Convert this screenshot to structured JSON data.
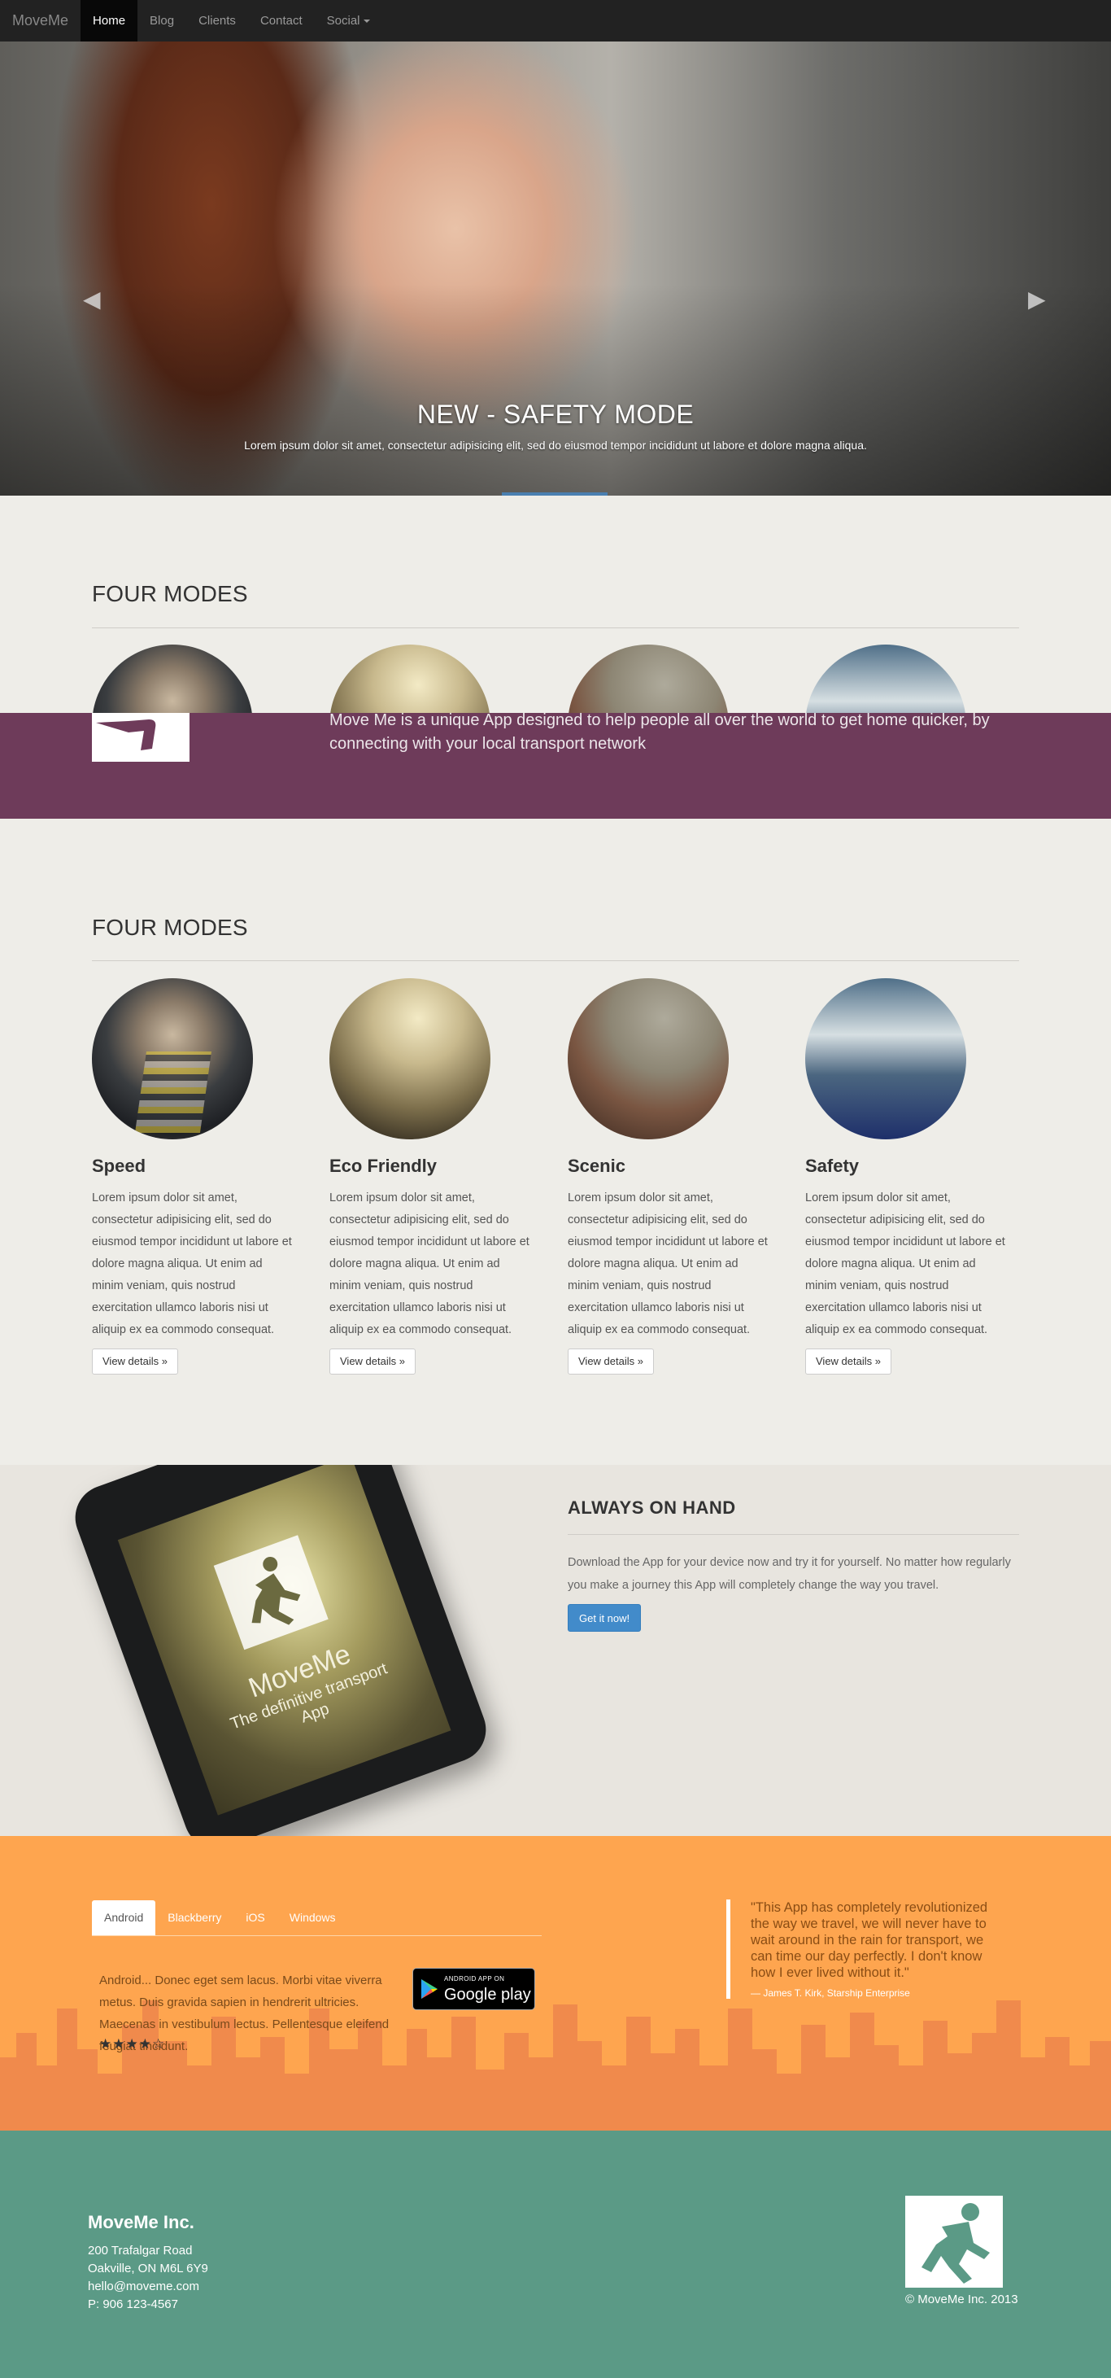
{
  "navbar": {
    "brand": "MoveMe",
    "items": [
      {
        "label": "Home",
        "active": true
      },
      {
        "label": "Blog",
        "active": false
      },
      {
        "label": "Clients",
        "active": false
      },
      {
        "label": "Contact",
        "active": false
      },
      {
        "label": "Social",
        "active": false,
        "dropdown": true
      }
    ]
  },
  "hero": {
    "title": "NEW - SAFETY MODE",
    "text": "Lorem ipsum dolor sit amet, consectetur adipisicing elit, sed do eiusmod tempor incididunt ut labore et dolore magna aliqua.",
    "prev_icon": "chevron-left-icon",
    "next_icon": "chevron-right-icon"
  },
  "intro": {
    "section_title": "FOUR MODES",
    "band_text": "Move Me is a unique App designed to help people all over the world to get home quicker, by connecting with your local transport network"
  },
  "modes": {
    "section_title": "FOUR MODES",
    "items": [
      {
        "title": "Speed",
        "text": "Lorem ipsum dolor sit amet, consectetur adipisicing elit, sed do eiusmod tempor incididunt ut labore et dolore magna aliqua. Ut enim ad minim veniam, quis nostrud exercitation ullamco laboris nisi ut aliquip ex ea commodo consequat.",
        "button": "View details »"
      },
      {
        "title": "Eco Friendly",
        "text": "Lorem ipsum dolor sit amet, consectetur adipisicing elit, sed do eiusmod tempor incididunt ut labore et dolore magna aliqua. Ut enim ad minim veniam, quis nostrud exercitation ullamco laboris nisi ut aliquip ex ea commodo consequat.",
        "button": "View details »"
      },
      {
        "title": "Scenic",
        "text": "Lorem ipsum dolor sit amet, consectetur adipisicing elit, sed do eiusmod tempor incididunt ut labore et dolore magna aliqua. Ut enim ad minim veniam, quis nostrud exercitation ullamco laboris nisi ut aliquip ex ea commodo consequat.",
        "button": "View details »"
      },
      {
        "title": "Safety",
        "text": "Lorem ipsum dolor sit amet, consectetur adipisicing elit, sed do eiusmod tempor incididunt ut labore et dolore magna aliqua. Ut enim ad minim veniam, quis nostrud exercitation ullamco laboris nisi ut aliquip ex ea commodo consequat.",
        "button": "View details »"
      }
    ]
  },
  "hand": {
    "title": "ALWAYS ON HAND",
    "text": "Download the App for your device now and try it for yourself. No matter how regularly you make a journey this App will completely change the way you travel.",
    "button": "Get it now!",
    "screen_title": "MoveMe",
    "screen_subtitle": "The definitive transport App"
  },
  "apps": {
    "tabs": [
      {
        "label": "Android",
        "active": true
      },
      {
        "label": "Blackberry",
        "active": false
      },
      {
        "label": "iOS",
        "active": false
      },
      {
        "label": "Windows",
        "active": false
      }
    ],
    "tab_text": "Android... Donec eget sem lacus. Morbi vitae viverra metus. Duis gravida sapien in hendrerit ultricies. Maecenas in vestibulum lectus. Pellentesque eleifend feugiat tincidunt.",
    "stars": "★★★★☆",
    "rating": 4,
    "gplay_small": "ANDROID APP ON",
    "gplay_big": "Google play"
  },
  "quote": {
    "text": "\"This App has completely revolutionized the way we travel, we will never have to wait around in the rain for transport, we can time our day perfectly. I don't know how I ever lived without it.\"",
    "author": "— James T. Kirk, Starship Enterprise"
  },
  "footer": {
    "company": "MoveMe Inc.",
    "address_lines": [
      "200 Trafalgar Road",
      "Oakville, ON M6L 6Y9",
      "hello@moveme.com",
      "P: 906 123-4567"
    ],
    "copyright": "© MoveMe Inc. 2013"
  },
  "colors": {
    "accent": "#428bca",
    "band": "#6e3b5a",
    "orange": "#fea54f",
    "footer": "#5b9a86"
  }
}
